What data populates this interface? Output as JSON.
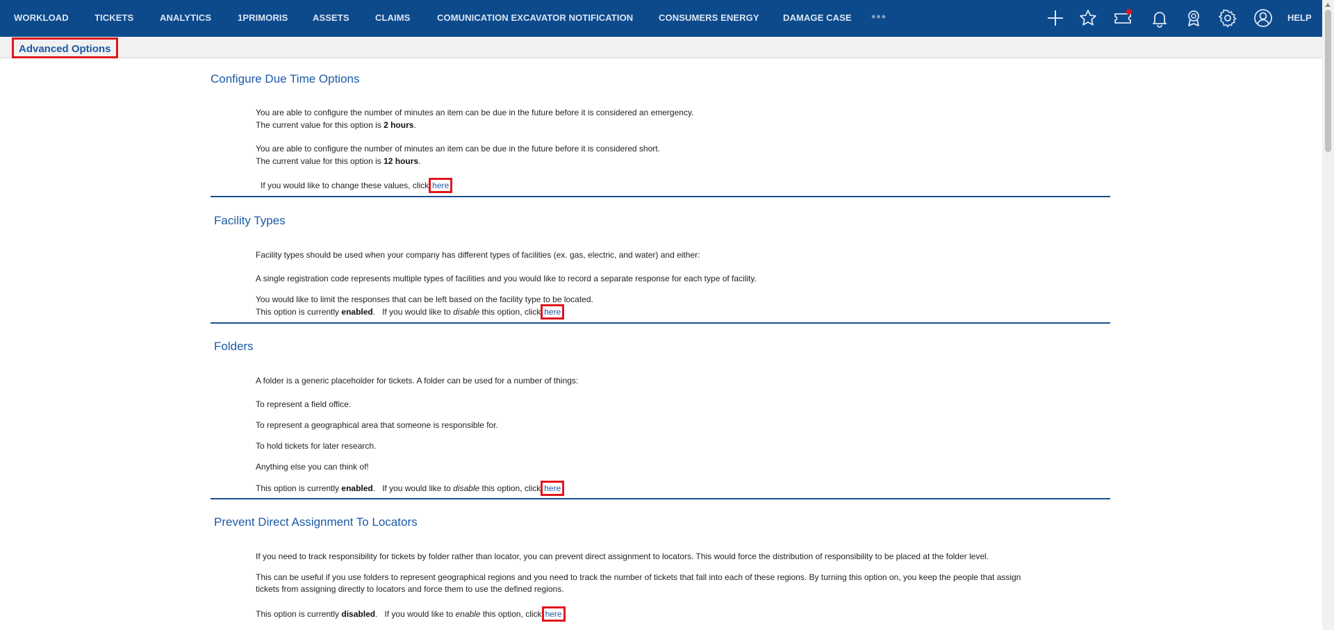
{
  "nav": {
    "items": [
      {
        "label": "WORKLOAD",
        "name": "nav-workload"
      },
      {
        "label": "TICKETS",
        "name": "nav-tickets"
      },
      {
        "label": "ANALYTICS",
        "name": "nav-analytics"
      },
      {
        "label": "1PRIMORIS",
        "name": "nav-1primoris"
      },
      {
        "label": "ASSETS",
        "name": "nav-assets"
      },
      {
        "label": "CLAIMS",
        "name": "nav-claims"
      },
      {
        "label": "COMUNICATION EXCAVATOR NOTIFICATION",
        "name": "nav-comunication-excavator-notification"
      },
      {
        "label": "CONSUMERS ENERGY",
        "name": "nav-consumers-energy"
      },
      {
        "label": "DAMAGE CASE",
        "name": "nav-damage-case"
      }
    ],
    "more": "•••",
    "icons": [
      "plus-icon",
      "star-icon",
      "ticket-notification-icon",
      "bell-icon",
      "award-icon",
      "gear-icon",
      "user-icon"
    ],
    "help": "HELP",
    "colors": {
      "bar": "#0d4a8c",
      "accent_dot": "#e0161e"
    }
  },
  "page": {
    "title": "Advanced Options",
    "link_text": "here",
    "sections": {
      "due_time": {
        "heading": "Configure Due Time Options",
        "emergency_text": "You are able to configure the number of minutes an item can be due in the future before it is considered an emergency.",
        "emergency_value_prefix": "The current value for this option is ",
        "emergency_value": "2 hours",
        "short_text": "You are able to configure the number of minutes an item can be due in the future before it is considered short.",
        "short_value_prefix": "The current value for this option is ",
        "short_value": "12 hours",
        "change_prefix": "If you would like to change these values, click"
      },
      "facility_types": {
        "heading": "Facility Types",
        "intro": "Facility types should be used when your company has different types of facilities (ex. gas, electric, and water) and either:",
        "point1": "A single registration code represents multiple types of facilities and you would like to record a separate response for each type of facility.",
        "point2": "You would like to limit the responses that can be left based on the facility type to be located.",
        "status_prefix": "This option is currently ",
        "status": "enabled",
        "action_prefix": ".   If you would like to ",
        "action": "disable",
        "action_suffix": " this option, click"
      },
      "folders": {
        "heading": "Folders",
        "intro": "A folder is a generic placeholder for tickets.  A folder can be used for a number of things:",
        "uses": [
          "To represent a field office.",
          "To represent a geographical area that someone is responsible for.",
          "To hold tickets for later research.",
          "Anything else you can think of!"
        ],
        "status_prefix": "This option is currently ",
        "status": "enabled",
        "action_prefix": ".   If you would like to ",
        "action": "disable",
        "action_suffix": " this option, click"
      },
      "prevent_direct": {
        "heading": "Prevent Direct Assignment To Locators",
        "p1": "If you need to track responsibility for tickets by folder rather than locator, you can prevent direct assignment to locators.  This would force the distribution of responsibility to be placed at the folder level.",
        "p2_line1": "This can be useful if you use folders to represent geographical regions and you need to track the number of tickets that fall into each of these regions.  By turning this option on, you keep the people that assign",
        "p2_line2": "tickets from assigning directly to locators and force them to use the defined regions.",
        "status_prefix": "This option is currently ",
        "status": "disabled",
        "action_prefix": ".   If you would like to ",
        "action": "enable",
        "action_suffix": " this option, click"
      }
    }
  }
}
